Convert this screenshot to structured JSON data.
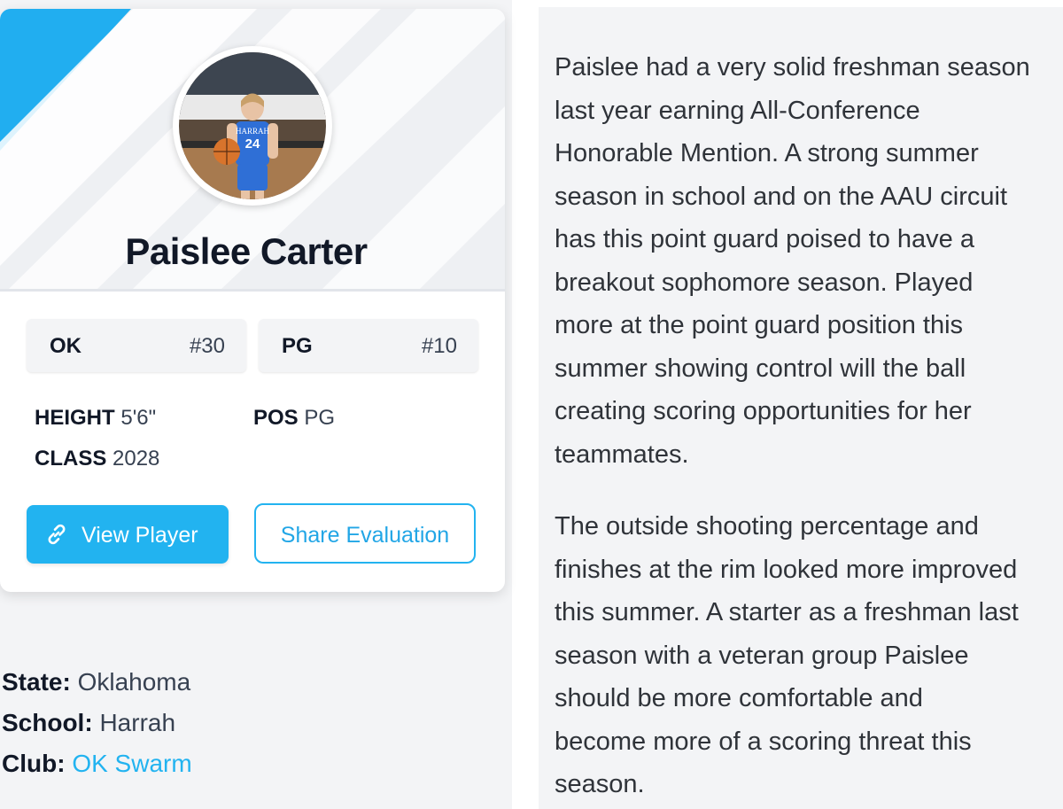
{
  "player": {
    "name": "Paislee Carter",
    "photo_jersey_text": "HARRAH",
    "photo_jersey_number": "24"
  },
  "stats": [
    {
      "key": "OK",
      "value": "#30"
    },
    {
      "key": "PG",
      "value": "#10"
    }
  ],
  "details": {
    "height_label": "HEIGHT",
    "height_value": "5'6\"",
    "pos_label": "POS",
    "pos_value": "PG",
    "class_label": "CLASS",
    "class_value": "2028"
  },
  "buttons": {
    "view_player": "View Player",
    "share_evaluation": "Share Evaluation"
  },
  "meta": {
    "state_label": "State:",
    "state_value": "Oklahoma",
    "school_label": "School:",
    "school_value": "Harrah",
    "club_label": "Club:",
    "club_value": "OK Swarm"
  },
  "evaluation": {
    "paragraph_1": "Paislee had a very solid freshman season\nlast year earning All-Conference\nHonorable Mention. A strong summer\nseason in school and on the AAU circuit\nhas this point guard poised to have a\nbreakout sophomore season. Played\nmore at the point guard position this\nsummer showing control will the ball\ncreating scoring opportunities for her\nteammates.",
    "paragraph_2": "The outside shooting percentage and\nfinishes at the rim looked more improved\nthis summer. A starter as a freshman last\nseason with a veteran group Paislee\nshould be more comfortable and\nbecome more of a scoring threat this\nseason."
  },
  "colors": {
    "accent": "#22b3f0",
    "text_dark": "#111827",
    "text_body": "#374151",
    "panel_bg": "#f3f4f6"
  },
  "icons": {
    "view_player": "link-icon"
  }
}
